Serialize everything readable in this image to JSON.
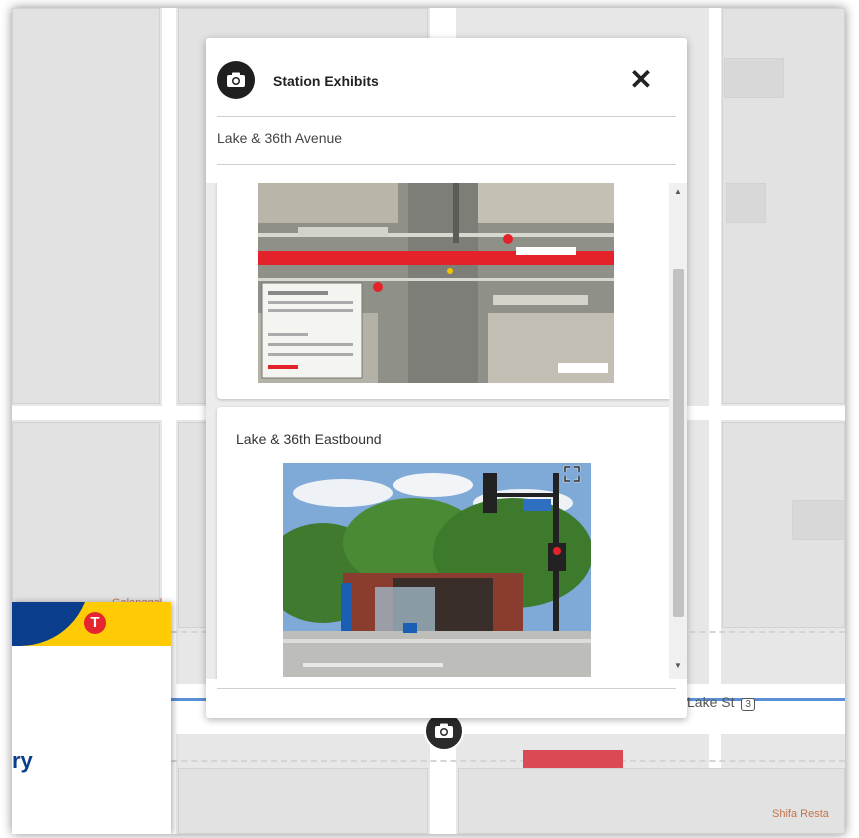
{
  "popup": {
    "title": "Station Exhibits",
    "subtitle": "Lake & 36th Avenue",
    "close_icon": "close-icon",
    "header_icon": "camera-icon",
    "exhibits": [
      {
        "title": "",
        "image": "station-plan-diagram"
      },
      {
        "title": "Lake & 36th Eastbound",
        "image": "station-photo",
        "expand_icon": "fullscreen-icon"
      }
    ]
  },
  "map": {
    "street_label": "Lake St",
    "route_shield": "3",
    "poi_left": "Galanggal",
    "poi_right": "Shifa Resta",
    "marker_icon": "camera-icon",
    "route_color": "#5a8fd6",
    "highlight_color": "#d94a55"
  },
  "side_card": {
    "text_fragment": "ry",
    "logo_letter": "T",
    "brand_yellow": "#ffcb05",
    "brand_blue": "#0a3e8c",
    "brand_red": "#e4242e"
  }
}
